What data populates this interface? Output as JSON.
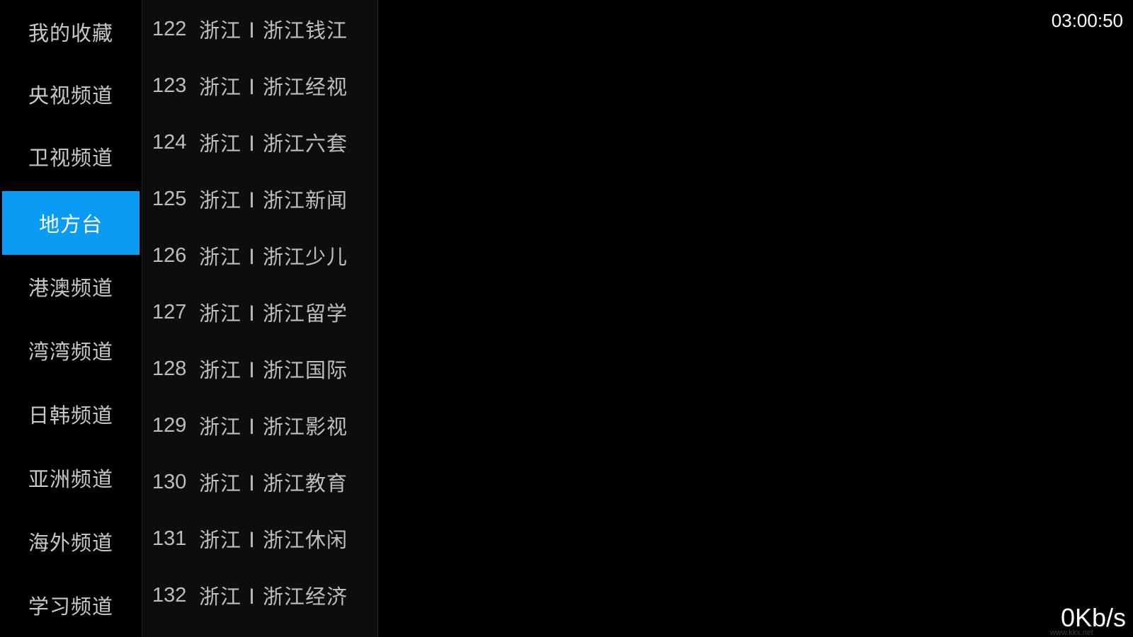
{
  "categories": [
    {
      "label": "我的收藏"
    },
    {
      "label": "央视频道"
    },
    {
      "label": "卫视频道"
    },
    {
      "label": "地方台",
      "selected": true
    },
    {
      "label": "港澳频道"
    },
    {
      "label": "湾湾频道"
    },
    {
      "label": "日韩频道"
    },
    {
      "label": "亚洲频道"
    },
    {
      "label": "海外频道"
    },
    {
      "label": "学习频道"
    }
  ],
  "channels": [
    {
      "number": "122",
      "name": "浙江 I 浙江钱江"
    },
    {
      "number": "123",
      "name": "浙江 I 浙江经视"
    },
    {
      "number": "124",
      "name": "浙江 I 浙江六套"
    },
    {
      "number": "125",
      "name": "浙江 I 浙江新闻"
    },
    {
      "number": "126",
      "name": "浙江 I 浙江少儿"
    },
    {
      "number": "127",
      "name": "浙江 I 浙江留学"
    },
    {
      "number": "128",
      "name": "浙江 I 浙江国际"
    },
    {
      "number": "129",
      "name": "浙江 I 浙江影视"
    },
    {
      "number": "130",
      "name": "浙江 I 浙江教育"
    },
    {
      "number": "131",
      "name": "浙江 I 浙江休闲"
    },
    {
      "number": "132",
      "name": "浙江 I 浙江经济"
    }
  ],
  "status": {
    "clock": "03:00:50",
    "net_speed": "0Kb/s",
    "watermark": "www.kkx.net"
  },
  "colors": {
    "selected_bg": "#0a9cf5",
    "background": "#000000",
    "panel_bg": "#0d0d0d"
  }
}
